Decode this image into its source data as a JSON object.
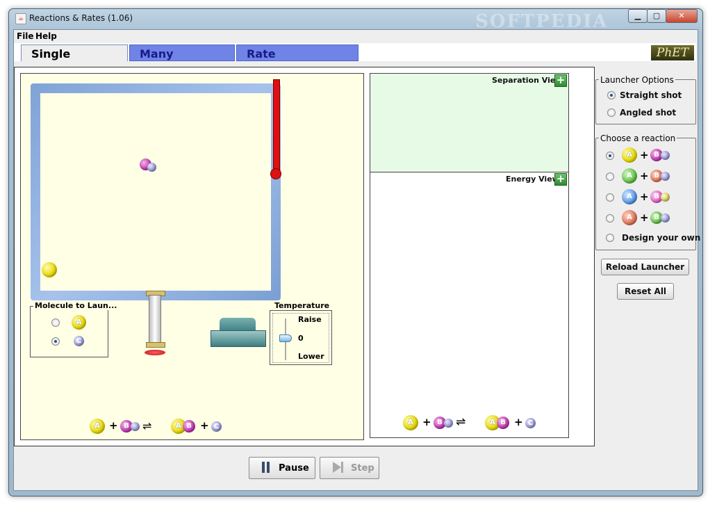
{
  "window": {
    "title": "Reactions & Rates (1.06)",
    "minimize": "▁",
    "maximize": "▢",
    "close": "✕",
    "watermark": "SOFTPEDIA"
  },
  "menu": [
    "File",
    "Help"
  ],
  "tabs": [
    {
      "label": "Single Collision",
      "active": true
    },
    {
      "label": "Many Collisions",
      "active": false
    },
    {
      "label": "Rate Experiments",
      "active": false
    }
  ],
  "logo": "PhET",
  "sim": {
    "molecule_panel": {
      "title": "Molecule to Laun...",
      "options": [
        {
          "mol": "A",
          "selected": false
        },
        {
          "mol": "C",
          "selected": true
        }
      ]
    },
    "temperature": {
      "title": "Temperature",
      "raise": "Raise",
      "value": "0",
      "lower": "Lower"
    },
    "equation": [
      "A",
      "+",
      "BC",
      "⇌",
      "AB",
      "+",
      "C"
    ],
    "molecules": {
      "A": "A",
      "B": "B",
      "C": "C"
    }
  },
  "views": {
    "separation": "Separation View",
    "energy": "Energy View",
    "plus": "+"
  },
  "launcher": {
    "title": "Launcher Options",
    "options": [
      {
        "label": "Straight shot",
        "selected": true
      },
      {
        "label": "Angled shot",
        "selected": false
      }
    ]
  },
  "reactions": {
    "title": "Choose a reaction",
    "design_own": "Design your own",
    "selected_index": 0
  },
  "buttons": {
    "reload": "Reload Launcher",
    "reset": "Reset All",
    "pause": "Pause",
    "step": "Step"
  },
  "colors": {
    "tab_inactive": "#6f84e6",
    "sim_background": "#ffffe6",
    "separation_background": "#e6fae6",
    "thermometer": "#e01010"
  }
}
